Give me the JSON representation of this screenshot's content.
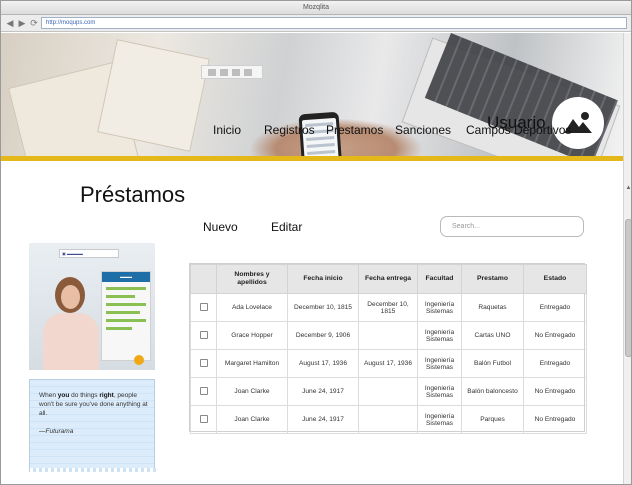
{
  "browser": {
    "title": "Mozqlita",
    "url": "http://moqups.com"
  },
  "header": {
    "user_label": "Usuario",
    "avatar_icon": "image-placeholder-icon",
    "menu": [
      "Inicio",
      "Registros",
      "Prestamos",
      "Sanciones",
      "Campos Deportivos"
    ],
    "accent_color": "#e3b818"
  },
  "page": {
    "title": "Préstamos",
    "new_label": "Nuevo",
    "edit_label": "Editar",
    "search_placeholder": "Search..."
  },
  "quote": {
    "text_parts": [
      "When ",
      "you",
      " do things ",
      "right",
      ", people won't be sure you've done anything at all."
    ],
    "author": "—Futurama"
  },
  "table": {
    "headers": [
      "",
      "Nombres y apellidos",
      "Fecha inicio",
      "Fecha entrega",
      "Facultad",
      "Prestamo",
      "Estado"
    ],
    "rows": [
      [
        "",
        "Ada Lovelace",
        "December 10, 1815",
        "December 10, 1815",
        "Ingeniería Sistemas",
        "Raquetas",
        "Entregado"
      ],
      [
        "",
        "Grace Hopper",
        "December 9, 1906",
        "",
        "Ingeniería Sistemas",
        "Cartas UNO",
        "No Entregado"
      ],
      [
        "",
        "Margaret Hamilton",
        "August 17, 1936",
        "August 17, 1936",
        "Ingeniería Sistemas",
        "Balón Futbol",
        "Entregado"
      ],
      [
        "",
        "Joan Clarke",
        "June 24, 1917",
        "",
        "Ingeniería Sistemas",
        "Balón baloncesto",
        "No Entregado"
      ],
      [
        "",
        "Joan Clarke",
        "June 24, 1917",
        "",
        "Ingeniería Sistemas",
        "Parques",
        "No Entregado"
      ]
    ]
  }
}
